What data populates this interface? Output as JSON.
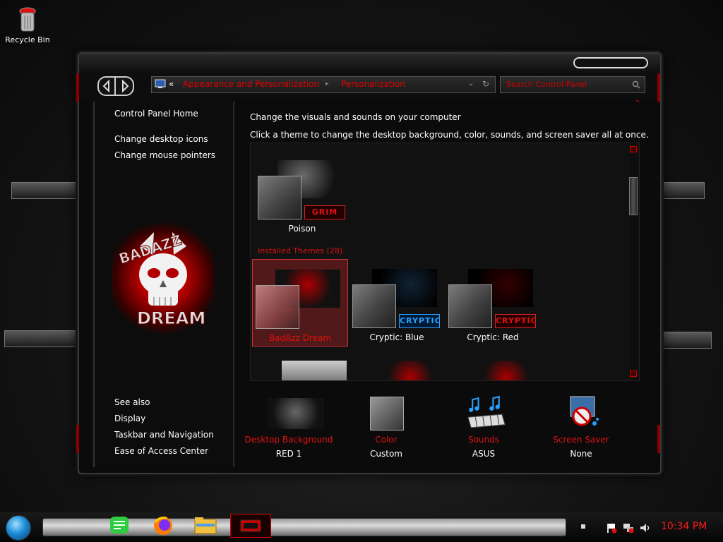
{
  "desktop": {
    "recycle_bin_label": "Recycle Bin"
  },
  "window": {
    "address": {
      "prefix": "«",
      "crumb1": "Appearance and Personalization",
      "separator": "▸",
      "crumb2": "Personalization"
    },
    "search_placeholder": "Search Control Panel"
  },
  "sidebar": {
    "home_link": "Control Panel Home",
    "links": [
      "Change desktop icons",
      "Change mouse pointers"
    ],
    "see_also_title": "See also",
    "see_also": [
      "Display",
      "Taskbar and Navigation",
      "Ease of Access Center"
    ],
    "logo_top_text": "BADAZZ",
    "logo_bottom_text": "DREAM"
  },
  "main": {
    "heading": "Change the visuals and sounds on your computer",
    "subheading": "Click a theme to change the desktop background, color, sounds, and screen saver all at once.",
    "my_themes": [
      {
        "name": "Poison",
        "badge": "GRIM"
      }
    ],
    "installed_label": "Installed Themes (28)",
    "installed_themes": [
      {
        "name": "BadAzz Dream",
        "badge": "",
        "selected": true
      },
      {
        "name": "Cryptic: Blue",
        "badge": "CRYPTIC",
        "selected": false
      },
      {
        "name": "Cryptic: Red",
        "badge": "CRYPTIC",
        "selected": false
      }
    ]
  },
  "bottom": {
    "desktop_background": {
      "label": "Desktop Background",
      "value": "RED 1"
    },
    "color": {
      "label": "Color",
      "value": "Custom"
    },
    "sounds": {
      "label": "Sounds",
      "value": "ASUS"
    },
    "screen_saver": {
      "label": "Screen Saver",
      "value": "None"
    }
  },
  "taskbar": {
    "clock": "10:34 PM"
  },
  "colors": {
    "accent_red": "#e01010",
    "badge_blue": "#2aa0ff"
  }
}
